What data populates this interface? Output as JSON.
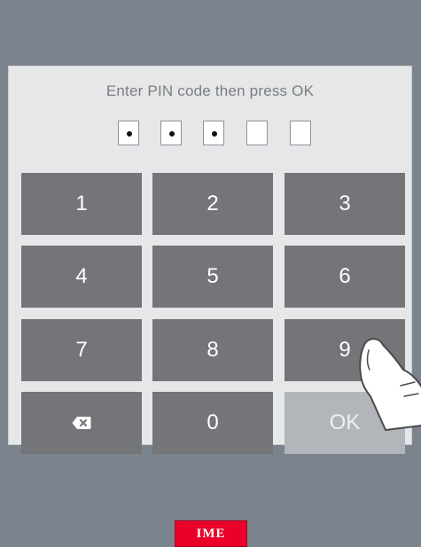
{
  "prompt": "Enter PIN code then press OK",
  "pin": {
    "total_digits": 5,
    "filled_digits": 3
  },
  "keypad": {
    "rows": [
      [
        "1",
        "2",
        "3"
      ],
      [
        "4",
        "5",
        "6"
      ],
      [
        "7",
        "8",
        "9"
      ],
      [
        "backspace",
        "0",
        "OK"
      ]
    ],
    "labels": {
      "k1": "1",
      "k2": "2",
      "k3": "3",
      "k4": "4",
      "k5": "5",
      "k6": "6",
      "k7": "7",
      "k8": "8",
      "k9": "9",
      "k0": "0",
      "ok": "OK"
    },
    "backspace_icon": "backspace-icon"
  },
  "footer": {
    "logo_text": "IME",
    "logo_color": "#ea0029"
  },
  "colors": {
    "background": "#7b838c",
    "panel": "#e6e7e8",
    "key": "#747579",
    "ok_key": "#b2b5b9"
  },
  "icons": [
    "backspace-icon",
    "pointer-hand-icon"
  ]
}
